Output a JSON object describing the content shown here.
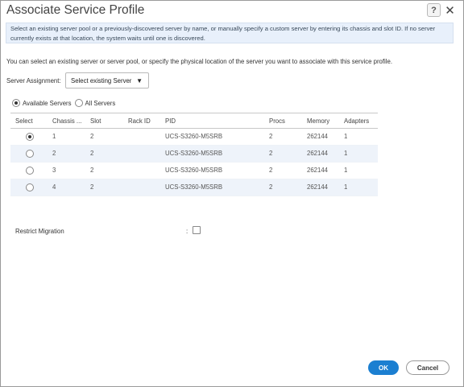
{
  "dialog": {
    "title": "Associate Service Profile",
    "help_icon": "?",
    "close_icon": "✕",
    "info_text": "Select an existing server pool or a previously-discovered server by name, or manually specify a custom server by entering its chassis and slot ID. If no server currently exists at that location, the system waits until one is discovered.",
    "description": "You can select an existing server or server pool, or specify the physical location of the server you want to associate with this service profile."
  },
  "assignment": {
    "label": "Server Assignment:",
    "selected": "Select existing Server",
    "arrow": "▼"
  },
  "filter": {
    "available_label": "Available Servers",
    "all_label": "All Servers",
    "selected": "available"
  },
  "table": {
    "headers": [
      "Select",
      "Chassis ...",
      "Slot",
      "Rack ID",
      "PID",
      "Procs",
      "Memory",
      "Adapters"
    ],
    "rows": [
      {
        "selected": true,
        "chassis": "1",
        "slot": "2",
        "rack_id": "",
        "pid": "UCS-S3260-M5SRB",
        "procs": "2",
        "memory": "262144",
        "adapters": "1"
      },
      {
        "selected": false,
        "chassis": "2",
        "slot": "2",
        "rack_id": "",
        "pid": "UCS-S3260-M5SRB",
        "procs": "2",
        "memory": "262144",
        "adapters": "1"
      },
      {
        "selected": false,
        "chassis": "3",
        "slot": "2",
        "rack_id": "",
        "pid": "UCS-S3260-M5SRB",
        "procs": "2",
        "memory": "262144",
        "adapters": "1"
      },
      {
        "selected": false,
        "chassis": "4",
        "slot": "2",
        "rack_id": "",
        "pid": "UCS-S3260-M5SRB",
        "procs": "2",
        "memory": "262144",
        "adapters": "1"
      }
    ]
  },
  "restrict": {
    "label": "Restrict Migration",
    "colon": ":",
    "checked": false
  },
  "buttons": {
    "ok": "OK",
    "cancel": "Cancel"
  },
  "colors": {
    "accent": "#1b7fd1",
    "info_bg": "#e8f0fb",
    "alt_row": "#eef3fa"
  }
}
